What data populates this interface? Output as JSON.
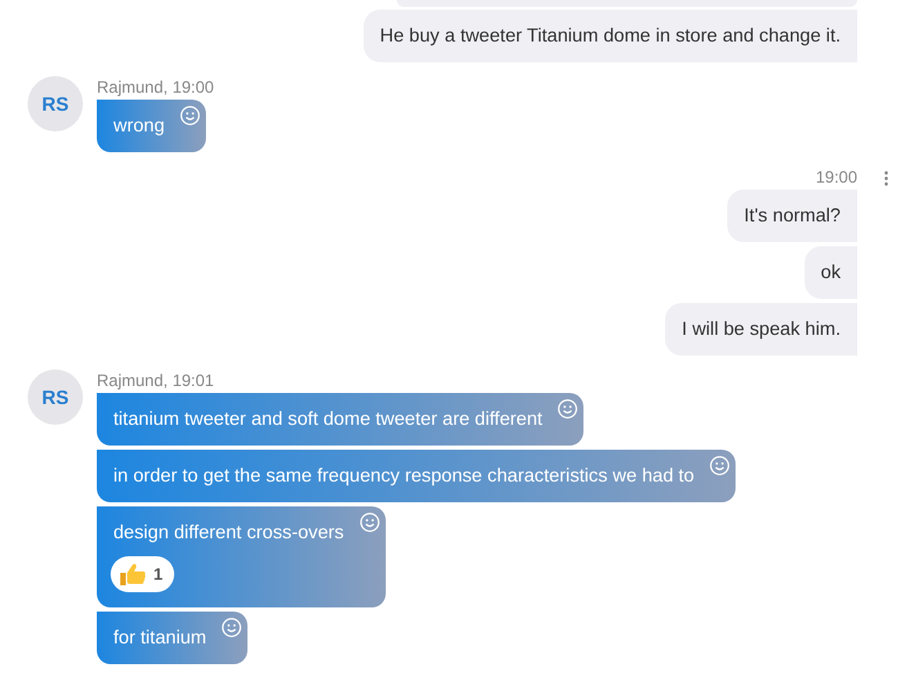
{
  "groups": [
    {
      "kind": "outgoing",
      "bubbles": [
        {
          "text": "He buy a tweeter Titanium dome in store and change it."
        }
      ]
    },
    {
      "kind": "incoming",
      "avatar": "RS",
      "header": "Rajmund, 19:00",
      "bubbles": [
        {
          "text": "wrong"
        }
      ]
    },
    {
      "kind": "outgoing",
      "time": "19:00",
      "bubbles": [
        {
          "text": "It's normal?"
        },
        {
          "text": "ok"
        },
        {
          "text": "I will be speak him."
        }
      ]
    },
    {
      "kind": "incoming",
      "avatar": "RS",
      "header": "Rajmund, 19:01",
      "bubbles": [
        {
          "text": "titanium tweeter and soft dome tweeter are different"
        },
        {
          "text": "in order to get the same frequency response characteristics we had to"
        },
        {
          "text": "design different cross-overs",
          "reactions": [
            {
              "count": "1"
            }
          ]
        },
        {
          "text": "for titanium"
        }
      ]
    }
  ]
}
